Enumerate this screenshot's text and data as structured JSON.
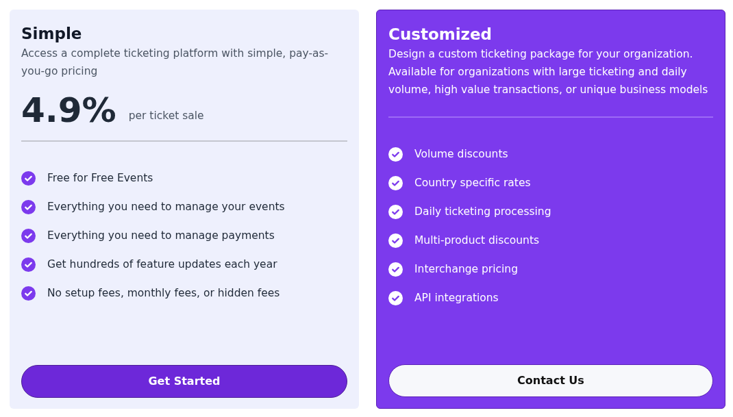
{
  "plans": [
    {
      "kind": "light",
      "title": "Simple",
      "description": "Access a complete ticketing platform with simple, pay-as-you-go pricing",
      "price": "4.9%",
      "price_unit": "per ticket sale",
      "features": [
        "Free for Free Events",
        "Everything you need to manage your events",
        "Everything you need to manage payments",
        "Get hundreds of feature updates each year",
        "No setup fees, monthly fees, or hidden fees"
      ],
      "button": "Get Started"
    },
    {
      "kind": "dark",
      "title": "Customized",
      "description": "Design a custom ticketing package for your organization. Available for organizations with large ticketing and daily volume, high value transactions, or unique business models",
      "features": [
        "Volume discounts",
        "Country specific rates",
        "Daily ticketing processing",
        "Multi-product discounts",
        "Interchange pricing",
        "API integrations"
      ],
      "button": "Contact Us"
    }
  ]
}
